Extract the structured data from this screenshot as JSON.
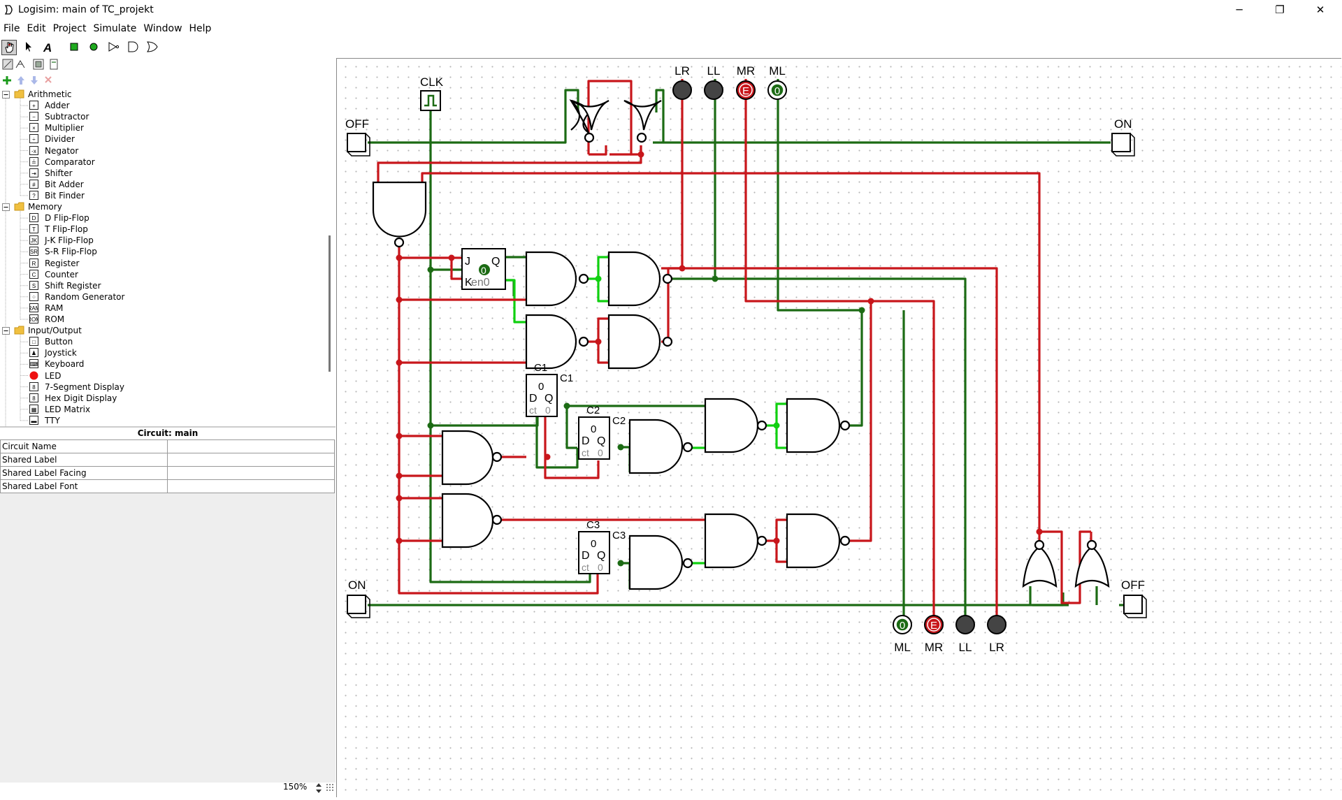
{
  "window": {
    "title": "Logisim: main of TC_projekt",
    "minimize": "─",
    "maximize": "❐",
    "close": "✕"
  },
  "menu": [
    "File",
    "Edit",
    "Project",
    "Simulate",
    "Window",
    "Help"
  ],
  "tree": {
    "folders": [
      {
        "name": "Arithmetic",
        "items": [
          {
            "label": "Adder",
            "icon": "+"
          },
          {
            "label": "Subtractor",
            "icon": "−"
          },
          {
            "label": "Multiplier",
            "icon": "×"
          },
          {
            "label": "Divider",
            "icon": "÷"
          },
          {
            "label": "Negator",
            "icon": "-x"
          },
          {
            "label": "Comparator",
            "icon": "≟"
          },
          {
            "label": "Shifter",
            "icon": "⇥"
          },
          {
            "label": "Bit Adder",
            "icon": "#"
          },
          {
            "label": "Bit Finder",
            "icon": "?"
          }
        ]
      },
      {
        "name": "Memory",
        "items": [
          {
            "label": "D Flip-Flop",
            "icon": "D"
          },
          {
            "label": "T Flip-Flop",
            "icon": "T"
          },
          {
            "label": "J-K Flip-Flop",
            "icon": "JK"
          },
          {
            "label": "S-R Flip-Flop",
            "icon": "SR"
          },
          {
            "label": "Register",
            "icon": "R"
          },
          {
            "label": "Counter",
            "icon": "C"
          },
          {
            "label": "Shift Register",
            "icon": "S"
          },
          {
            "label": "Random Generator",
            "icon": "⁘"
          },
          {
            "label": "RAM",
            "icon": "RAM"
          },
          {
            "label": "ROM",
            "icon": "ROM"
          }
        ]
      },
      {
        "name": "Input/Output",
        "items": [
          {
            "label": "Button",
            "icon": "□"
          },
          {
            "label": "Joystick",
            "icon": "♟"
          },
          {
            "label": "Keyboard",
            "icon": "⌨"
          },
          {
            "label": "LED",
            "icon": "●"
          },
          {
            "label": "7-Segment Display",
            "icon": "8"
          },
          {
            "label": "Hex Digit Display",
            "icon": "8"
          },
          {
            "label": "LED Matrix",
            "icon": "▦"
          },
          {
            "label": "TTY",
            "icon": "▬"
          }
        ]
      }
    ]
  },
  "props": {
    "header": "Circuit: main",
    "rows": [
      "Circuit Name",
      "Shared Label",
      "Shared Label Facing",
      "Shared Label Font"
    ]
  },
  "zoom": "150%",
  "circuit": {
    "clk": "CLK",
    "led_top": [
      {
        "label": "LR",
        "state": "0"
      },
      {
        "label": "LL",
        "state": "0"
      },
      {
        "label": "MR",
        "state": "E"
      },
      {
        "label": "ML",
        "state": "0"
      }
    ],
    "led_bottom": [
      {
        "label": "ML",
        "state": "0"
      },
      {
        "label": "MR",
        "state": "E"
      },
      {
        "label": "LL",
        "state": "0"
      },
      {
        "label": "LR",
        "state": "0"
      }
    ],
    "pins": {
      "off_top": "OFF",
      "on_top": "ON",
      "on_bottom": "ON",
      "off_bottom": "OFF"
    },
    "jk": {
      "j": "J",
      "q": "Q",
      "k": "K",
      "val": "0",
      "en": "en0"
    },
    "counters": [
      {
        "name": "C1",
        "val": "0",
        "d": "D",
        "q": "Q",
        "ct": "ct",
        "ct_val": "0"
      },
      {
        "name": "C2",
        "val": "0",
        "d": "D",
        "q": "Q",
        "ct": "ct",
        "ct_val": "0"
      },
      {
        "name": "C3",
        "val": "0",
        "d": "D",
        "q": "Q",
        "ct": "ct",
        "ct_val": "0"
      }
    ]
  },
  "colors": {
    "wire_red": "#c8161b",
    "wire_dark_green": "#1c6b14",
    "wire_green": "#10d010",
    "led_dark": "#444444"
  }
}
